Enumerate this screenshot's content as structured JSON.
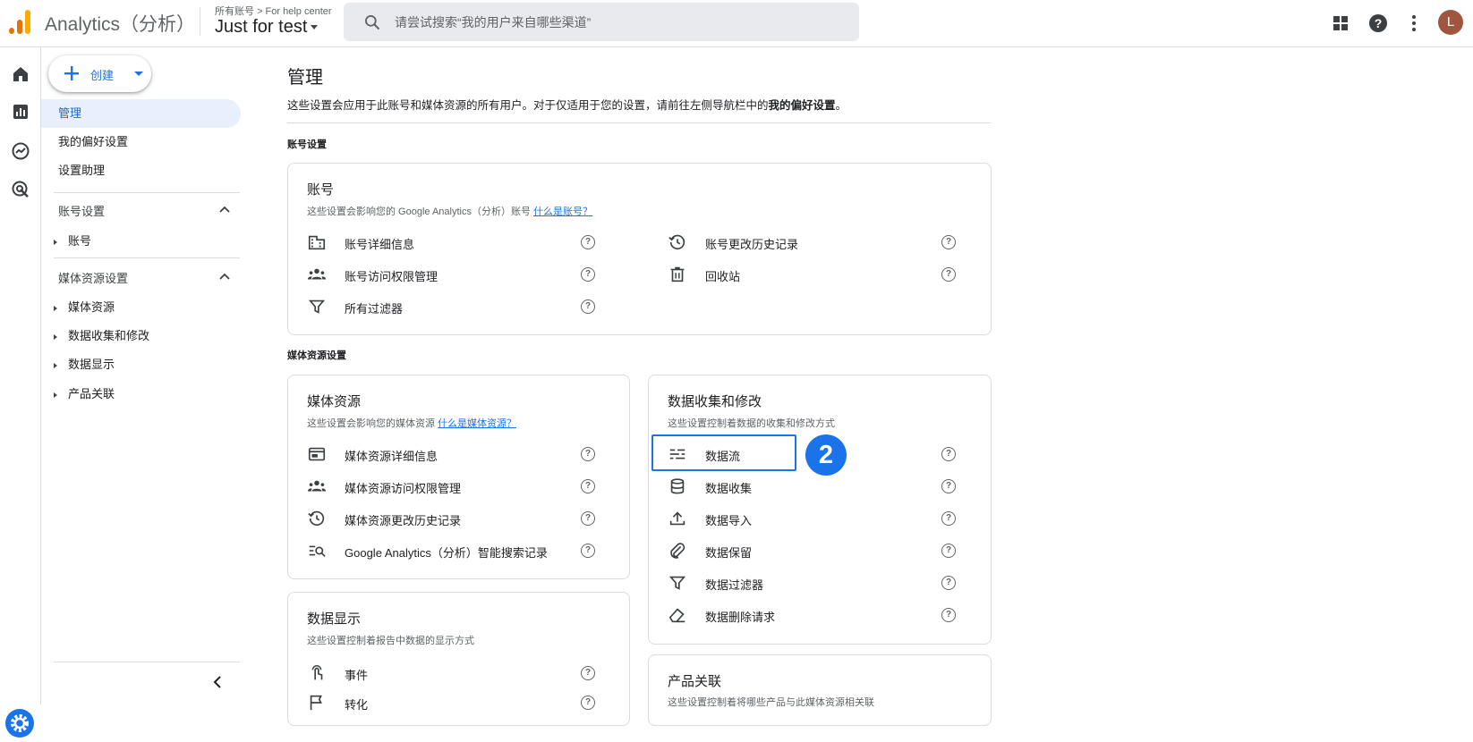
{
  "app": {
    "title": "Analytics（分析）",
    "breadcrumb_root": "所有账号",
    "breadcrumb_child": "For help center",
    "account_name": "Just for test",
    "avatar_letter": "L"
  },
  "search": {
    "placeholder": "请尝试搜索“我的用户来自哪些渠道”"
  },
  "colors": {
    "accent": "#1a73e8",
    "active_bg": "#e8f0fe",
    "logo_orange": "#f9ab00",
    "logo_dark": "#e37400"
  },
  "sidebar": {
    "create_label": "创建",
    "items": [
      "管理",
      "我的偏好设置",
      "设置助理"
    ],
    "account_section": "账号设置",
    "account_items": [
      "账号"
    ],
    "property_section": "媒体资源设置",
    "property_items": [
      "媒体资源",
      "数据收集和修改",
      "数据显示",
      "产品关联"
    ]
  },
  "main": {
    "title": "管理",
    "intro_text": "这些设置会应用于此账号和媒体资源的所有用户。对于仅适用于您的设置，请前往左侧导航栏中的",
    "intro_bold": "我的偏好设置",
    "intro_end": "。",
    "account_section_label": "账号设置",
    "property_section_label": "媒体资源设置",
    "account_card": {
      "title": "账号",
      "desc": "这些设置会影响您的 Google Analytics（分析）账号 ",
      "link": "什么是账号？",
      "left_rows": [
        {
          "label": "账号详细信息",
          "icon": "building-icon"
        },
        {
          "label": "账号访问权限管理",
          "icon": "people-icon"
        },
        {
          "label": "所有过滤器",
          "icon": "filter-icon"
        }
      ],
      "right_rows": [
        {
          "label": "账号更改历史记录",
          "icon": "history-icon"
        },
        {
          "label": "回收站",
          "icon": "trash-icon"
        }
      ]
    },
    "property_card": {
      "title": "媒体资源",
      "desc": "这些设置会影响您的媒体资源 ",
      "link": "什么是媒体资源？",
      "rows": [
        {
          "label": "媒体资源详细信息",
          "icon": "web-icon"
        },
        {
          "label": "媒体资源访问权限管理",
          "icon": "people-icon"
        },
        {
          "label": "媒体资源更改历史记录",
          "icon": "history-icon"
        },
        {
          "label": "Google Analytics（分析）智能搜索记录",
          "icon": "search-list-icon"
        }
      ]
    },
    "data_collection_card": {
      "title": "数据收集和修改",
      "desc": "这些设置控制着数据的收集和修改方式",
      "rows": [
        {
          "label": "数据流",
          "icon": "streams-icon"
        },
        {
          "label": "数据收集",
          "icon": "database-icon"
        },
        {
          "label": "数据导入",
          "icon": "upload-icon"
        },
        {
          "label": "数据保留",
          "icon": "paperclip-icon"
        },
        {
          "label": "数据过滤器",
          "icon": "filter-icon"
        },
        {
          "label": "数据删除请求",
          "icon": "eraser-icon"
        }
      ]
    },
    "data_display_card": {
      "title": "数据显示",
      "desc": "这些设置控制着报告中数据的显示方式",
      "rows": [
        {
          "label": "事件",
          "icon": "touch-icon"
        },
        {
          "label": "转化",
          "icon": "flag-icon"
        }
      ]
    },
    "product_links_card": {
      "title": "产品关联",
      "desc": "这些设置控制着将哪些产品与此媒体资源相关联"
    },
    "step_badge": "2"
  }
}
